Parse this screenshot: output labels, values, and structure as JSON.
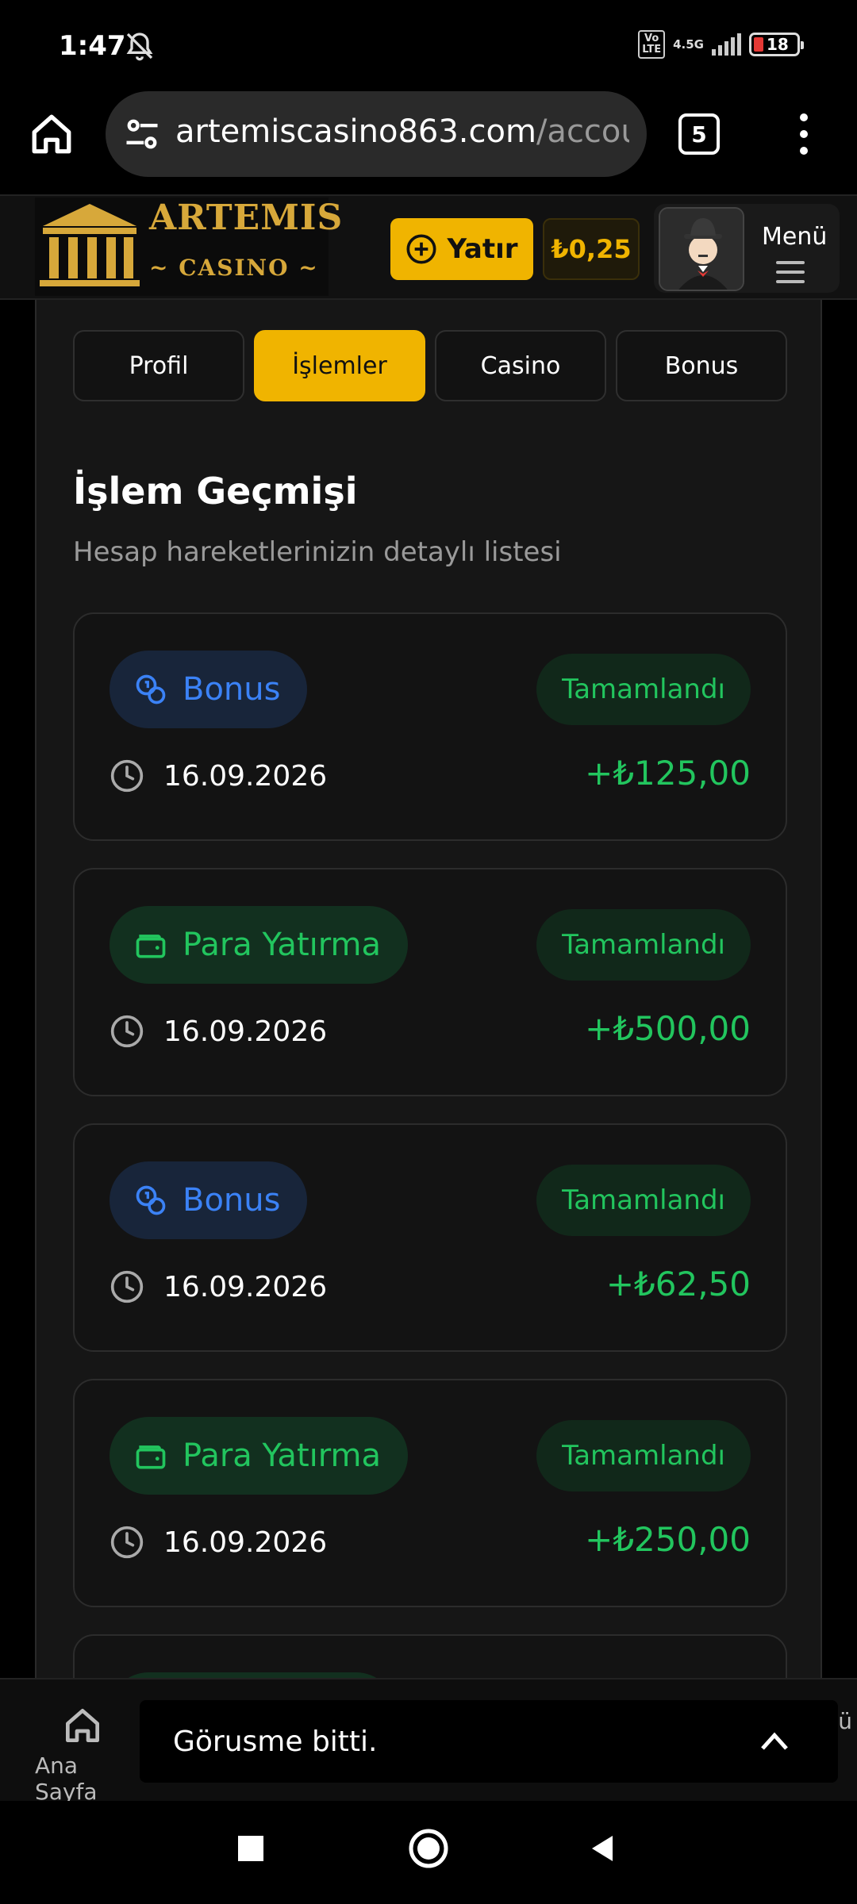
{
  "status_bar": {
    "time": "1:47",
    "volte": "Vo\nLTE",
    "network": "4.5G",
    "battery": "18"
  },
  "browser": {
    "url_main": "artemiscasino863.com",
    "url_rest": "/accou",
    "tabs_count": "5"
  },
  "header": {
    "logo_title": "ARTEMIS",
    "logo_sub": "CASINO",
    "deposit_label": "Yatır",
    "balance": "₺0,25",
    "menu_label": "Menü"
  },
  "tabs": [
    {
      "label": "Profil",
      "active": false
    },
    {
      "label": "İşlemler",
      "active": true
    },
    {
      "label": "Casino",
      "active": false
    },
    {
      "label": "Bonus",
      "active": false
    }
  ],
  "section": {
    "title": "İşlem Geçmişi",
    "subtitle": "Hesap hareketlerinizin detaylı listesi"
  },
  "transactions": [
    {
      "type": "Bonus",
      "kind": "bonus",
      "status": "Tamamlandı",
      "date": "16.09.2026",
      "amount": "+₺125,00"
    },
    {
      "type": "Para Yatırma",
      "kind": "deposit",
      "status": "Tamamlandı",
      "date": "16.09.2026",
      "amount": "+₺500,00"
    },
    {
      "type": "Bonus",
      "kind": "bonus",
      "status": "Tamamlandı",
      "date": "16.09.2026",
      "amount": "+₺62,50"
    },
    {
      "type": "Para Yatırma",
      "kind": "deposit",
      "status": "Tamamlandı",
      "date": "16.09.2026",
      "amount": "+₺250,00"
    }
  ],
  "bottom_nav": {
    "home_label": "Ana Sayfa",
    "toast": "Görusme bitti.",
    "tail": "ü"
  },
  "colors": {
    "accent": "#f0b400",
    "success": "#22c55e",
    "bonus": "#3b82f6"
  }
}
